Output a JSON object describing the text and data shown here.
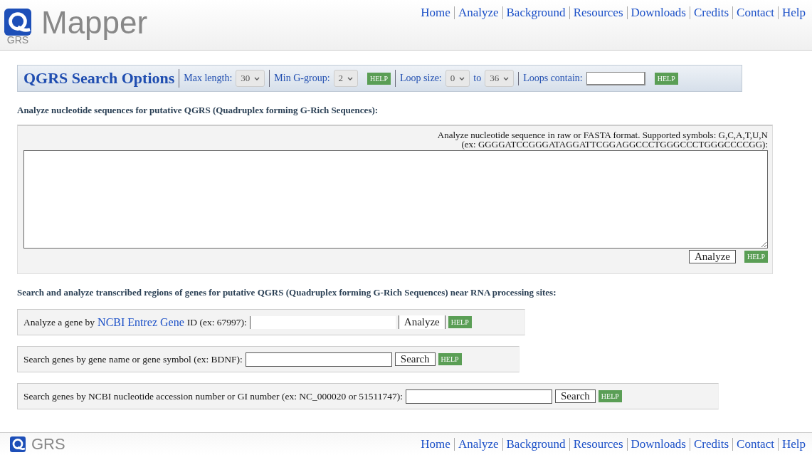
{
  "header": {
    "logo_sub": "GRS",
    "logo_title": "Mapper",
    "nav": [
      "Home",
      "Analyze",
      "Background",
      "Resources",
      "Downloads",
      "Credits",
      "Contact",
      "Help"
    ]
  },
  "options": {
    "title": "QGRS Search Options",
    "fields": [
      {
        "kind": "select",
        "label": "Max length:",
        "value": "30"
      },
      {
        "kind": "select",
        "label": "Min G-group:",
        "value": "2",
        "help": "HELP"
      },
      {
        "kind": "range",
        "label": "Loop size:",
        "value": "0",
        "joiner": "to",
        "value2": "36"
      },
      {
        "kind": "text",
        "label": "Loops contain:",
        "help": "HELP"
      }
    ]
  },
  "sequence_section": {
    "heading": "Analyze nucleotide sequences for putative QGRS (Quadruplex forming G-Rich Sequences):",
    "hint": "Analyze nucleotide sequence in raw or FASTA format. Supported symbols: G,C,A,T,U,N",
    "example": "(ex: GGGGATCCGGGATAGGATTCGGAGGCCCTGGGCCCTGGGCCCCGG):",
    "button": "Analyze",
    "help": "HELP"
  },
  "gene_section": {
    "heading": "Search and analyze transcribed regions of genes for putative QGRS (Quadruplex forming G-Rich Sequences) near RNA processing sites:",
    "rows": [
      {
        "kind": "flat",
        "before": "Analyze a gene by",
        "link": "NCBI Entrez Gene",
        "after": "ID (ex: 67997):",
        "button": "Analyze",
        "help": "HELP"
      },
      {
        "kind": "boxed",
        "before": "Search genes by gene name or gene symbol (ex: BDNF):",
        "button": "Search",
        "help": "HELP"
      },
      {
        "kind": "boxed",
        "before": "Search genes by NCBI nucleotide accession number or GI number (ex: NC_000020 or 51511747):",
        "button": "Search",
        "help": "HELP"
      }
    ]
  },
  "footer": {
    "logo_sub": "GRS",
    "nav": [
      "Home",
      "Analyze",
      "Background",
      "Resources",
      "Downloads",
      "Credits",
      "Contact",
      "Help"
    ]
  }
}
